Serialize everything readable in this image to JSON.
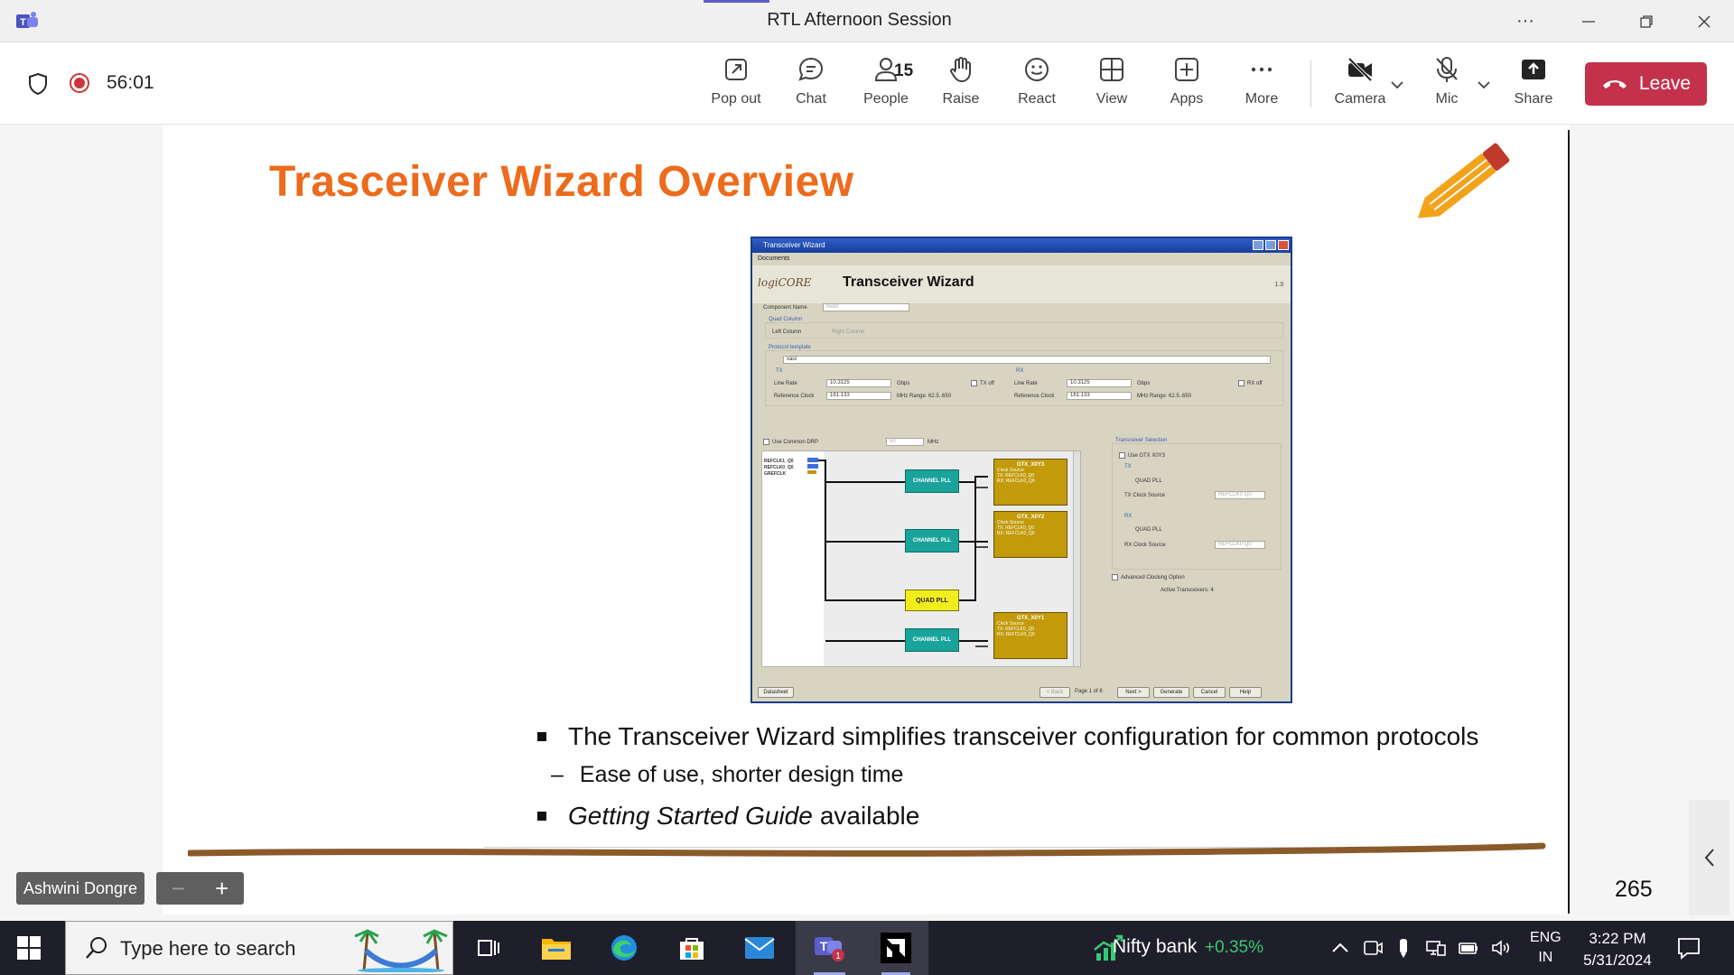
{
  "window": {
    "title": "RTL Afternoon Session"
  },
  "meeting": {
    "timer": "56:01",
    "toolbar": {
      "popout": "Pop out",
      "chat": "Chat",
      "people": "People",
      "people_count": "15",
      "raise": "Raise",
      "react": "React",
      "view": "View",
      "apps": "Apps",
      "more": "More",
      "camera": "Camera",
      "mic": "Mic",
      "share": "Share",
      "leave": "Leave"
    },
    "participant_name": "Ashwini Dongre",
    "zoom_minus": "−",
    "zoom_plus": "+"
  },
  "slide": {
    "title": "Trasceiver Wizard Overview",
    "bullets": [
      {
        "text": "The Transceiver Wizard simplifies transceiver configuration for common protocols"
      },
      {
        "text": "Ease of use, shorter design time"
      }
    ],
    "bullet3_italic": "Getting Started Guide",
    "bullet3_rest": "available",
    "page_number": "265",
    "dash": "–"
  },
  "wizard": {
    "window_title": "Transceiver Wizard",
    "menu": "Documents",
    "logo": "logiCORE",
    "heading": "Transceiver Wizard",
    "version": "1.3",
    "component_name_label": "Component Name",
    "component_name_value": "foobr",
    "quad_column": "Quad Column",
    "left_column": "Left Column",
    "right_column": "Right Column",
    "protocol_template": "Protocol template",
    "protocol_value": "xaui",
    "tx": "TX",
    "rx": "RX",
    "line_rate": "Line Rate",
    "tx_line_rate": "10.3125",
    "rx_line_rate": "10.3125",
    "gbps": "Gbps",
    "tx_off": "TX off",
    "rx_off": "RX off",
    "reference_clock": "Reference Clock",
    "tx_ref_clock": "161.133",
    "rx_ref_clock": "161.133",
    "mhz_range": "MHz  Range: 62.5..650",
    "use_common_drp": "Use Common DRP",
    "drp_value": "50",
    "mhz": "MHz",
    "refclk1": "REFCLK1_Q0",
    "refclk0": "REFCLK0_Q0",
    "grefclk": "GREFCLK",
    "channel_pll": "CHANNEL PLL",
    "quad_pll": "QUAD PLL",
    "gtx3": "GTX_X0Y3",
    "gtx2": "GTX_X0Y2",
    "gtx1": "GTX_X0Y1",
    "gtx_detail": "Clock Source",
    "gtx_tx": "TX: REFCLK0_Q0",
    "gtx_rx": "RX: REFCLK0_Q0",
    "transceiver_selection": "Transceiver Selection",
    "use_gtx": "Use GTX X0Y3",
    "quad_pll_opt": "QUAD PLL",
    "tx_clock_source": "TX Clock Source",
    "rx_clock_source": "RX Clock Source",
    "clock_source_value": "REFCLK0 Q0",
    "advanced_clocking": "Advanced Clocking Option",
    "active_transceivers": "Active Transceivers: 4",
    "datasheet": "Datasheet",
    "back": "< Back",
    "page_of": "Page 1 of 6",
    "next": "Next >",
    "generate": "Generate",
    "cancel": "Cancel",
    "help": "Help"
  },
  "taskbar": {
    "search_placeholder": "Type here to search",
    "teams_badge": "1",
    "widget_label": "Nifty bank",
    "widget_value": "+0.35%",
    "lang_1": "ENG",
    "lang_2": "IN",
    "time": "3:22 PM",
    "date": "5/31/2024"
  },
  "colors": {
    "slide_title": "#ec6b1c",
    "leave": "#c4314b",
    "record": "#d13438",
    "teams_accent": "#5b5fc7",
    "widget_positive": "#37c871"
  }
}
